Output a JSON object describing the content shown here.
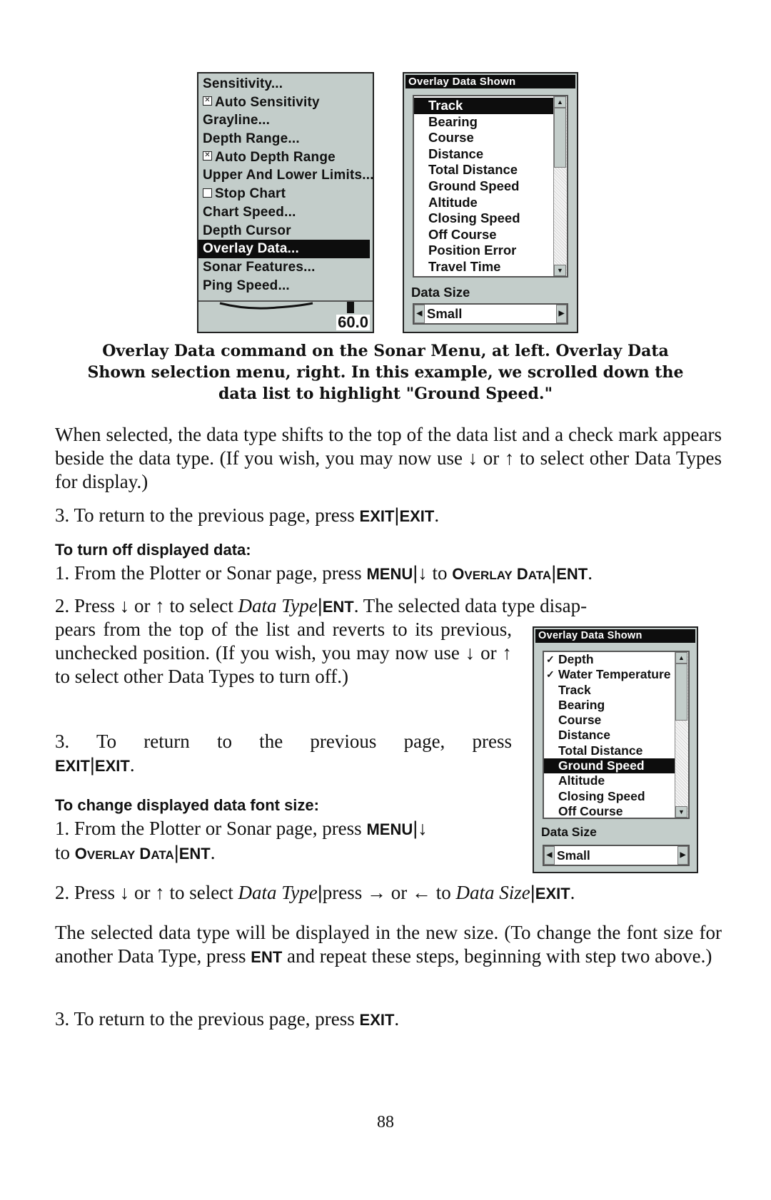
{
  "sonar_menu": {
    "items": [
      {
        "label": "Sensitivity...",
        "checkbox": null,
        "selected": false
      },
      {
        "label": "Auto Sensitivity",
        "checkbox": "checked",
        "selected": false
      },
      {
        "label": "Grayline...",
        "checkbox": null,
        "selected": false
      },
      {
        "label": "Depth Range...",
        "checkbox": null,
        "selected": false
      },
      {
        "label": "Auto Depth Range",
        "checkbox": "checked",
        "selected": false
      },
      {
        "label": "Upper And Lower Limits...",
        "checkbox": null,
        "selected": false
      },
      {
        "label": "Stop Chart",
        "checkbox": "unchecked",
        "selected": false
      },
      {
        "label": "Chart Speed...",
        "checkbox": null,
        "selected": false
      },
      {
        "label": "Depth Cursor",
        "checkbox": null,
        "selected": false
      },
      {
        "label": "Overlay Data...",
        "checkbox": null,
        "selected": true
      },
      {
        "label": "Sonar Features...",
        "checkbox": null,
        "selected": false
      },
      {
        "label": "Ping Speed...",
        "checkbox": null,
        "selected": false
      }
    ],
    "depth_readout": "60.0"
  },
  "overlay_dialog_1": {
    "title": "Overlay Data Shown",
    "items": [
      {
        "label": "Track",
        "checked": false,
        "selected": true
      },
      {
        "label": "Bearing",
        "checked": false,
        "selected": false
      },
      {
        "label": "Course",
        "checked": false,
        "selected": false
      },
      {
        "label": "Distance",
        "checked": false,
        "selected": false
      },
      {
        "label": "Total Distance",
        "checked": false,
        "selected": false
      },
      {
        "label": "Ground Speed",
        "checked": false,
        "selected": false
      },
      {
        "label": "Altitude",
        "checked": false,
        "selected": false
      },
      {
        "label": "Closing Speed",
        "checked": false,
        "selected": false
      },
      {
        "label": "Off Course",
        "checked": false,
        "selected": false
      },
      {
        "label": "Position Error",
        "checked": false,
        "selected": false
      },
      {
        "label": "Travel Time",
        "checked": false,
        "selected": false
      }
    ],
    "data_size_label": "Data Size",
    "data_size_value": "Small"
  },
  "overlay_dialog_2": {
    "title": "Overlay Data Shown",
    "items": [
      {
        "label": "Depth",
        "checked": true,
        "selected": false
      },
      {
        "label": "Water Temperature",
        "checked": true,
        "selected": false
      },
      {
        "label": "Track",
        "checked": false,
        "selected": false
      },
      {
        "label": "Bearing",
        "checked": false,
        "selected": false
      },
      {
        "label": "Course",
        "checked": false,
        "selected": false
      },
      {
        "label": "Distance",
        "checked": false,
        "selected": false
      },
      {
        "label": "Total Distance",
        "checked": false,
        "selected": false
      },
      {
        "label": "Ground Speed",
        "checked": false,
        "selected": true
      },
      {
        "label": "Altitude",
        "checked": false,
        "selected": false
      },
      {
        "label": "Closing Speed",
        "checked": false,
        "selected": false
      },
      {
        "label": "Off Course",
        "checked": false,
        "selected": false
      }
    ],
    "data_size_label": "Data Size",
    "data_size_value": "Small"
  },
  "caption": {
    "line1": "Overlay Data command on the Sonar Menu, at left. Overlay Data",
    "line2": "Shown selection menu, right. In this example, we scrolled down the",
    "line3": "data list to highlight \"Ground Speed.\""
  },
  "text": {
    "p1": "When selected, the data type shifts to the top of the data list and a check mark appears beside the data type. (If you wish, you may now use",
    "p1_or": "or",
    "p1_end": "to select other Data Types for display.)",
    "step3a_prefix": "3. To return to the previous page, press",
    "key_exit": "EXIT",
    "key_menu": "MENU",
    "key_ent": "ENT",
    "sep": "|",
    "arrow_down": "↓",
    "arrow_up": "↑",
    "arrow_right": "→",
    "arrow_left": "←",
    "heading_off": "To turn off displayed data:",
    "off_step1_prefix": "1. From the Plotter or Sonar page, press",
    "to": "to",
    "overlay_O": "O",
    "overlay_rest": "VERLAY",
    "data_D": "D",
    "data_rest": "ATA",
    "off_step2_prefix": "2. Press",
    "off_step2_mid": "to select",
    "data_type": "Data Type",
    "off_step2_rest": ". The selected data type disap-",
    "off_step2_cont": "pears from the top of the list and reverts to its previous, unchecked position. (If you wish, you may now use",
    "off_step2_end": "to select other Data Types to turn off.)",
    "off_step3_prefix": "3. To return to the previous page, press",
    "heading_font": "To change displayed data font size:",
    "font_step1_prefix": "1. From the Plotter or Sonar page, press",
    "font_step2_prefix": "2. Press",
    "font_step2_mid": "to select",
    "press": "press",
    "data_size": "Data Size",
    "final_para_a": "The selected data type will be displayed in the new size. (To change the font size for another Data Type, press",
    "final_para_b": "and repeat these steps, beginning with step two above.)",
    "final_step3_prefix": "3. To return to the previous page, press",
    "period": ".",
    "or": "or"
  },
  "page_number": "88"
}
